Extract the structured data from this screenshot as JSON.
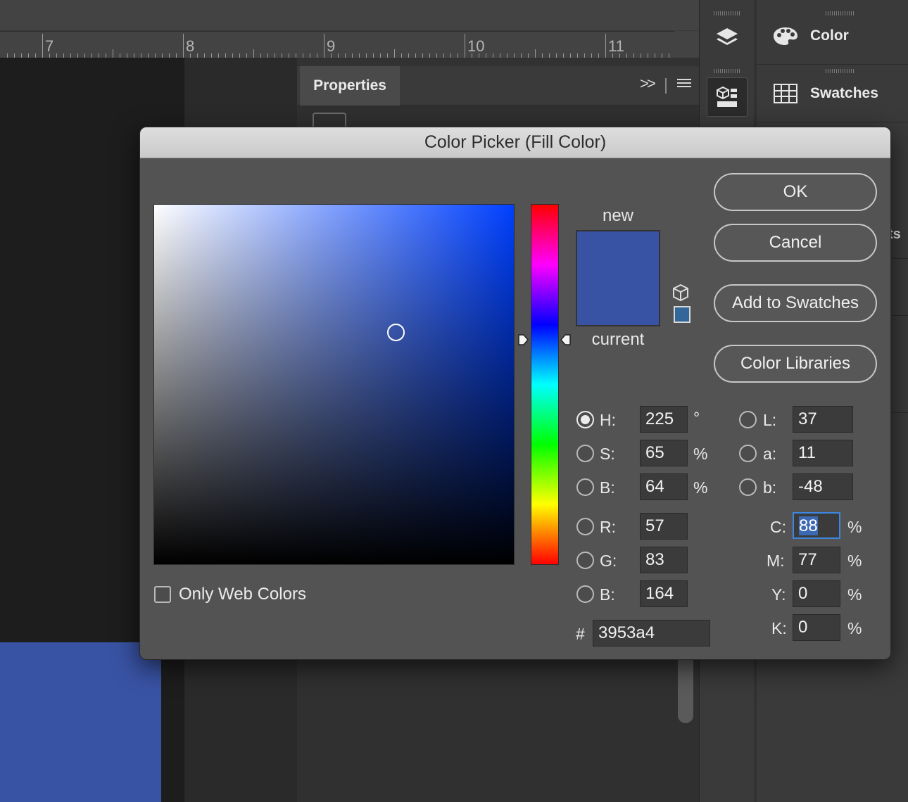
{
  "ruler": {
    "numbers": [
      "7",
      "8",
      "9",
      "10",
      "11"
    ]
  },
  "properties_panel": {
    "tab_label": "Properties",
    "collapse_glyph": ">>"
  },
  "right_panels": {
    "color_label": "Color",
    "swatches_label": "Swatches",
    "truncated_text": "ts"
  },
  "document": {
    "fill_color": "#3953a4"
  },
  "dialog": {
    "title": "Color Picker (Fill Color)",
    "new_label": "new",
    "current_label": "current",
    "new_color": "#3953a4",
    "current_color": "#3953a4",
    "websafe_color": "#336699",
    "buttons": {
      "ok": "OK",
      "cancel": "Cancel",
      "add_to_swatches": "Add to Swatches",
      "color_libraries": "Color Libraries"
    },
    "only_web_colors_label": "Only Web Colors",
    "only_web_colors_checked": false,
    "hsb": {
      "h": {
        "label": "H:",
        "value": "225",
        "unit": "°",
        "selected": true
      },
      "s": {
        "label": "S:",
        "value": "65",
        "unit": "%"
      },
      "b": {
        "label": "B:",
        "value": "64",
        "unit": "%"
      }
    },
    "rgb": {
      "r": {
        "label": "R:",
        "value": "57"
      },
      "g": {
        "label": "G:",
        "value": "83"
      },
      "b": {
        "label": "B:",
        "value": "164"
      }
    },
    "lab": {
      "l": {
        "label": "L:",
        "value": "37"
      },
      "a": {
        "label": "a:",
        "value": "11"
      },
      "b": {
        "label": "b:",
        "value": "-48"
      }
    },
    "cmyk": {
      "c": {
        "label": "C:",
        "value": "88",
        "unit": "%"
      },
      "m": {
        "label": "M:",
        "value": "77",
        "unit": "%"
      },
      "y": {
        "label": "Y:",
        "value": "0",
        "unit": "%"
      },
      "k": {
        "label": "K:",
        "value": "0",
        "unit": "%"
      }
    },
    "hex": {
      "label": "#",
      "value": "3953a4"
    }
  }
}
